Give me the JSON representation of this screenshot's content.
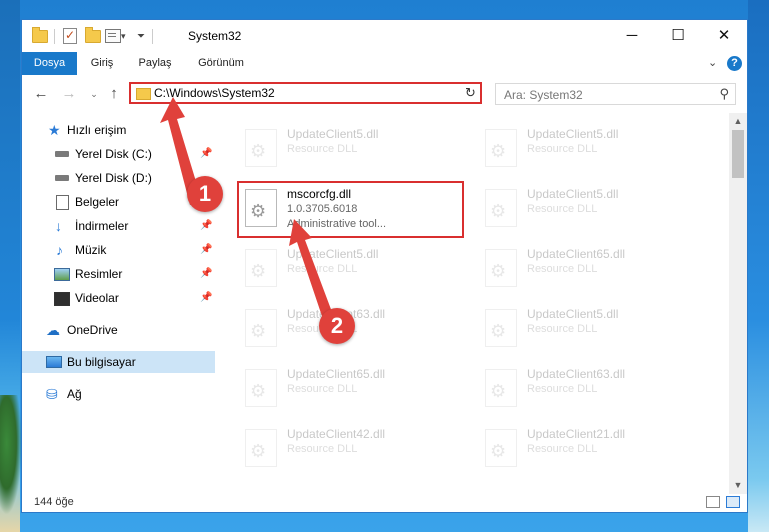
{
  "window": {
    "title": "System32",
    "controls": {
      "minimize": "─",
      "maximize": "☐",
      "close": "✕"
    }
  },
  "ribbon": {
    "tabs": [
      {
        "label": "Dosya",
        "active": true
      },
      {
        "label": "Giriş"
      },
      {
        "label": "Paylaş"
      },
      {
        "label": "Görünüm"
      }
    ],
    "help_label": "?"
  },
  "address": {
    "path": "C:\\Windows\\System32",
    "search_placeholder": "Ara: System32"
  },
  "sidebar": {
    "items": [
      {
        "label": "Hızlı erişim",
        "icon": "star-icon"
      },
      {
        "label": "Yerel Disk (C:)",
        "icon": "drive-icon",
        "pinned": true
      },
      {
        "label": "Yerel Disk (D:)",
        "icon": "drive-icon"
      },
      {
        "label": "Belgeler",
        "icon": "documents-icon",
        "pinned": true
      },
      {
        "label": "İndirmeler",
        "icon": "download-icon",
        "pinned": true
      },
      {
        "label": "Müzik",
        "icon": "music-icon",
        "pinned": true
      },
      {
        "label": "Resimler",
        "icon": "pictures-icon",
        "pinned": true
      },
      {
        "label": "Videolar",
        "icon": "videos-icon",
        "pinned": true
      },
      {
        "label": "OneDrive",
        "icon": "onedrive-icon"
      },
      {
        "label": "Bu bilgisayar",
        "icon": "this-pc-icon",
        "selected": true
      },
      {
        "label": "Ağ",
        "icon": "network-icon"
      }
    ]
  },
  "files": {
    "highlighted": {
      "name": "mscorcfg.dll",
      "version": "1.0.3705.6018",
      "description": "Administrative tool..."
    },
    "left": [
      {
        "name": "UpdateClient5.dll",
        "desc": "Resource DLL"
      },
      {
        "name": "UpdateClient5.dll",
        "desc": "Resource DLL"
      },
      {
        "name": "UpdateClient63.dll",
        "desc": "Resource DLL"
      },
      {
        "name": "UpdateClient65.dll",
        "desc": "Resource DLL"
      },
      {
        "name": "UpdateClient42.dll",
        "desc": "Resource DLL"
      }
    ],
    "right": [
      {
        "name": "UpdateClient5.dll",
        "desc": "Resource DLL"
      },
      {
        "name": "UpdateClient5.dll",
        "desc": "Resource DLL"
      },
      {
        "name": "UpdateClient65.dll",
        "desc": "Resource DLL"
      },
      {
        "name": "UpdateClient5.dll",
        "desc": "Resource DLL"
      },
      {
        "name": "UpdateClient63.dll",
        "desc": "Resource DLL"
      },
      {
        "name": "UpdateClient21.dll",
        "desc": "Resource DLL"
      }
    ]
  },
  "status": {
    "item_count": "144 öğe"
  },
  "annotations": {
    "step1": "1",
    "step2": "2",
    "color": "#e0413b"
  }
}
